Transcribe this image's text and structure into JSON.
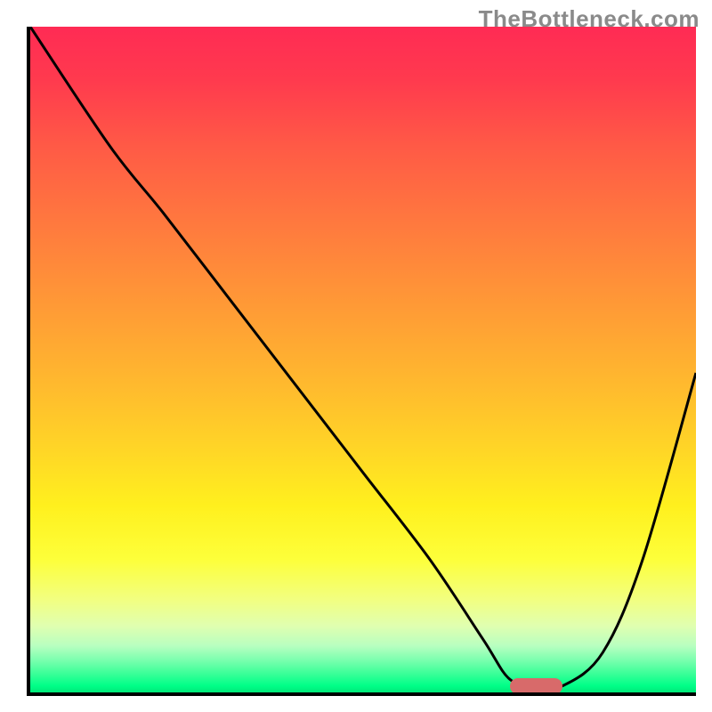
{
  "watermark": "TheBottleneck.com",
  "chart_data": {
    "type": "line",
    "title": "",
    "xlabel": "",
    "ylabel": "",
    "xlim": [
      0,
      100
    ],
    "ylim": [
      0,
      100
    ],
    "series": [
      {
        "name": "bottleneck-curve",
        "x": [
          0,
          12,
          20,
          30,
          40,
          50,
          60,
          68,
          72,
          76,
          80,
          86,
          92,
          100
        ],
        "y": [
          100,
          82,
          72,
          59,
          46,
          33,
          20,
          8,
          2,
          1,
          1,
          6,
          20,
          48
        ]
      }
    ],
    "marker": {
      "x_start": 72,
      "x_end": 80,
      "y": 1
    },
    "gradient_stops": [
      {
        "pos": 0,
        "color": "#ff2b54"
      },
      {
        "pos": 50,
        "color": "#ffc028"
      },
      {
        "pos": 80,
        "color": "#fff01e"
      },
      {
        "pos": 100,
        "color": "#00e878"
      }
    ],
    "grid": false,
    "legend": false
  }
}
